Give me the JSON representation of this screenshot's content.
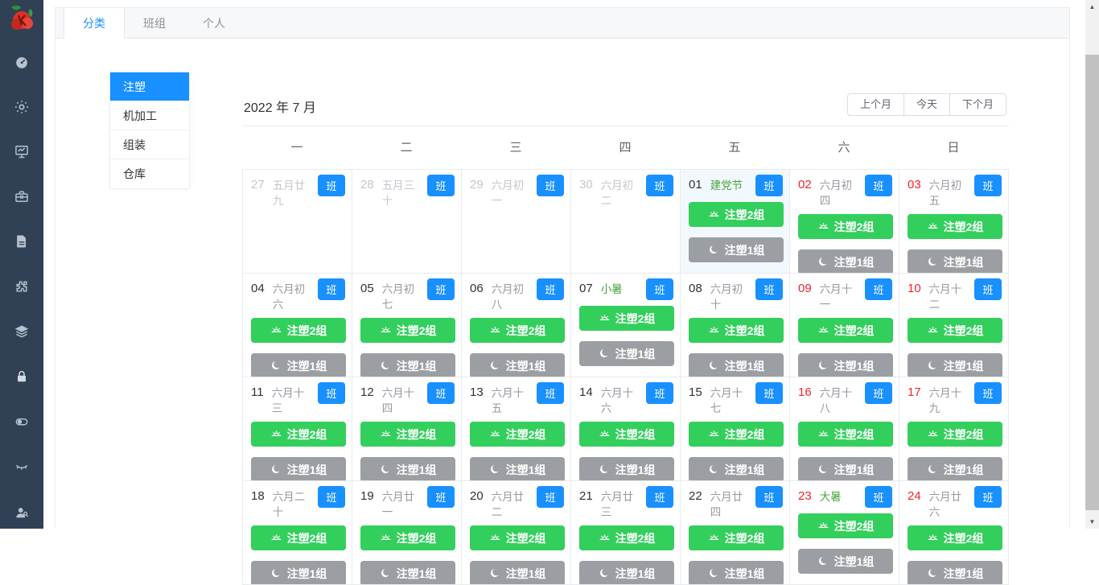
{
  "colors": {
    "sidebar": "#304156",
    "primary": "#1890ff",
    "green": "#33cf5c",
    "grayBtn": "#9b9ea3",
    "red": "#f5222d",
    "holiday": "#46a33c",
    "todayBg": "#f2f9fe"
  },
  "sidebar": {
    "icons": [
      "dashboard-icon",
      "settings-gear-icon",
      "monitor-chart-icon",
      "toolbox-icon",
      "document-icon",
      "puzzle-icon",
      "layers-icon",
      "lock-icon",
      "toggle-icon",
      "eye-closed-icon",
      "user-search-icon"
    ]
  },
  "tabs": [
    {
      "label": "分类",
      "active": true
    },
    {
      "label": "班组",
      "active": false
    },
    {
      "label": "个人",
      "active": false
    }
  ],
  "categories": [
    {
      "label": "注塑",
      "active": true
    },
    {
      "label": "机加工",
      "active": false
    },
    {
      "label": "组装",
      "active": false
    },
    {
      "label": "仓库",
      "active": false
    }
  ],
  "calendar": {
    "title": "2022 年 7 月",
    "nav": {
      "prev": "上个月",
      "today": "今天",
      "next": "下个月"
    },
    "weekdays": [
      "一",
      "二",
      "三",
      "四",
      "五",
      "六",
      "日"
    ],
    "badge_label": "班",
    "shift_morning_label": "注塑2组",
    "shift_night_label": "注塑1组",
    "cells": [
      {
        "day": "27",
        "lunar": "五月廿九",
        "muted": true,
        "weekend": false,
        "holiday": false,
        "today": false,
        "shifts": false
      },
      {
        "day": "28",
        "lunar": "五月三十",
        "muted": true,
        "weekend": false,
        "holiday": false,
        "today": false,
        "shifts": false
      },
      {
        "day": "29",
        "lunar": "六月初一",
        "muted": true,
        "weekend": false,
        "holiday": false,
        "today": false,
        "shifts": false
      },
      {
        "day": "30",
        "lunar": "六月初二",
        "muted": true,
        "weekend": false,
        "holiday": false,
        "today": false,
        "shifts": false
      },
      {
        "day": "01",
        "lunar": "建党节",
        "muted": false,
        "weekend": false,
        "holiday": true,
        "today": true,
        "shifts": true
      },
      {
        "day": "02",
        "lunar": "六月初四",
        "muted": false,
        "weekend": true,
        "holiday": false,
        "today": false,
        "shifts": true
      },
      {
        "day": "03",
        "lunar": "六月初五",
        "muted": false,
        "weekend": true,
        "holiday": false,
        "today": false,
        "shifts": true
      },
      {
        "day": "04",
        "lunar": "六月初六",
        "muted": false,
        "weekend": false,
        "holiday": false,
        "today": false,
        "shifts": true
      },
      {
        "day": "05",
        "lunar": "六月初七",
        "muted": false,
        "weekend": false,
        "holiday": false,
        "today": false,
        "shifts": true
      },
      {
        "day": "06",
        "lunar": "六月初八",
        "muted": false,
        "weekend": false,
        "holiday": false,
        "today": false,
        "shifts": true
      },
      {
        "day": "07",
        "lunar": "小暑",
        "muted": false,
        "weekend": false,
        "holiday": true,
        "today": false,
        "shifts": true
      },
      {
        "day": "08",
        "lunar": "六月初十",
        "muted": false,
        "weekend": false,
        "holiday": false,
        "today": false,
        "shifts": true
      },
      {
        "day": "09",
        "lunar": "六月十一",
        "muted": false,
        "weekend": true,
        "holiday": false,
        "today": false,
        "shifts": true
      },
      {
        "day": "10",
        "lunar": "六月十二",
        "muted": false,
        "weekend": true,
        "holiday": false,
        "today": false,
        "shifts": true
      },
      {
        "day": "11",
        "lunar": "六月十三",
        "muted": false,
        "weekend": false,
        "holiday": false,
        "today": false,
        "shifts": true
      },
      {
        "day": "12",
        "lunar": "六月十四",
        "muted": false,
        "weekend": false,
        "holiday": false,
        "today": false,
        "shifts": true
      },
      {
        "day": "13",
        "lunar": "六月十五",
        "muted": false,
        "weekend": false,
        "holiday": false,
        "today": false,
        "shifts": true
      },
      {
        "day": "14",
        "lunar": "六月十六",
        "muted": false,
        "weekend": false,
        "holiday": false,
        "today": false,
        "shifts": true
      },
      {
        "day": "15",
        "lunar": "六月十七",
        "muted": false,
        "weekend": false,
        "holiday": false,
        "today": false,
        "shifts": true
      },
      {
        "day": "16",
        "lunar": "六月十八",
        "muted": false,
        "weekend": true,
        "holiday": false,
        "today": false,
        "shifts": true
      },
      {
        "day": "17",
        "lunar": "六月十九",
        "muted": false,
        "weekend": true,
        "holiday": false,
        "today": false,
        "shifts": true
      },
      {
        "day": "18",
        "lunar": "六月二十",
        "muted": false,
        "weekend": false,
        "holiday": false,
        "today": false,
        "shifts": true
      },
      {
        "day": "19",
        "lunar": "六月廿一",
        "muted": false,
        "weekend": false,
        "holiday": false,
        "today": false,
        "shifts": true
      },
      {
        "day": "20",
        "lunar": "六月廿二",
        "muted": false,
        "weekend": false,
        "holiday": false,
        "today": false,
        "shifts": true
      },
      {
        "day": "21",
        "lunar": "六月廿三",
        "muted": false,
        "weekend": false,
        "holiday": false,
        "today": false,
        "shifts": true
      },
      {
        "day": "22",
        "lunar": "六月廿四",
        "muted": false,
        "weekend": false,
        "holiday": false,
        "today": false,
        "shifts": true
      },
      {
        "day": "23",
        "lunar": "大暑",
        "muted": false,
        "weekend": true,
        "holiday": true,
        "today": false,
        "shifts": true
      },
      {
        "day": "24",
        "lunar": "六月廿六",
        "muted": false,
        "weekend": true,
        "holiday": false,
        "today": false,
        "shifts": true
      }
    ]
  }
}
